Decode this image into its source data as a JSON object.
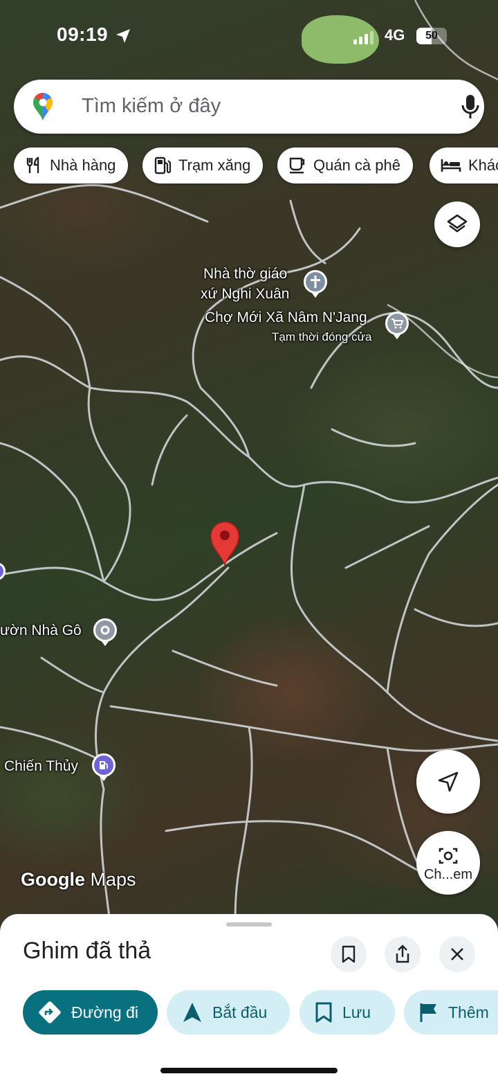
{
  "status_bar": {
    "time": "09:19",
    "network": "4G",
    "battery": "50",
    "battery_level": 0.5
  },
  "search": {
    "placeholder": "Tìm kiếm ở đây",
    "left_icon": "google-maps-pin-icon",
    "right_icon": "mic-icon"
  },
  "chips": [
    {
      "label": "Nhà hàng",
      "icon": "restaurant-icon"
    },
    {
      "label": "Trạm xăng",
      "icon": "gas-station-icon"
    },
    {
      "label": "Quán cà phê",
      "icon": "coffee-icon"
    },
    {
      "label": "Khác",
      "icon": "hotel-icon"
    }
  ],
  "map": {
    "labels": {
      "church_line1": "Nhà thờ giáo",
      "church_line2": "xứ Nghi Xuân",
      "market": "Chợ Mới Xã Nâm N'Jang",
      "market_status": "Tạm thời đóng cửa",
      "garden": "ườn Nhà Gô",
      "gas": "Chiến Thủy"
    },
    "watermark_google": "Google",
    "watermark_maps": "Maps",
    "lens_label": "Ch...em",
    "colors": {
      "pin": "#e53935",
      "poi_gray": "#8e99a3",
      "poi_church": "#7d8fa0",
      "poi_gas": "#6f63d8",
      "road": "#d9dde1"
    }
  },
  "sheet": {
    "title": "Ghim đã thả",
    "actions": [
      {
        "label": "Đường đi",
        "icon": "directions-icon"
      },
      {
        "label": "Bắt đầu",
        "icon": "navigation-arrow-icon"
      },
      {
        "label": "Lưu",
        "icon": "bookmark-icon"
      },
      {
        "label": "Thêm",
        "icon": "flag-icon"
      }
    ],
    "colors": {
      "primary": "#09707f",
      "secondary_bg": "#d3eef4"
    }
  }
}
